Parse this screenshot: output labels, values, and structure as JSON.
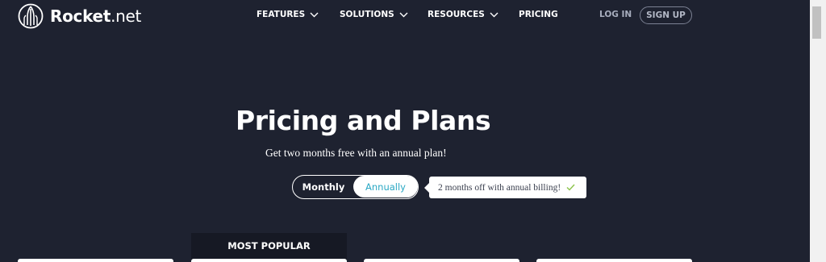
{
  "header": {
    "logo_text_bold": "Rocket",
    "logo_text_light": ".net",
    "nav": [
      {
        "label": "FEATURES",
        "has_dropdown": true
      },
      {
        "label": "SOLUTIONS",
        "has_dropdown": true
      },
      {
        "label": "RESOURCES",
        "has_dropdown": true
      },
      {
        "label": "PRICING",
        "has_dropdown": false
      }
    ],
    "login_label": "LOG IN",
    "signup_label": "SIGN UP"
  },
  "hero": {
    "title": "Pricing and Plans",
    "subtitle": "Get two months free with an annual plan!",
    "billing_toggle": {
      "options": [
        "Monthly",
        "Annually"
      ],
      "selected": "Annually"
    },
    "billing_note": "2 months off with annual billing!"
  },
  "plans": {
    "popular_label": "MOST POPULAR"
  },
  "icons": {
    "logo": "rocket-logo-icon",
    "dropdown": "chevron-down-icon",
    "note": "check-icon"
  },
  "colors": {
    "background": "#1e2230",
    "accent": "#2aa8c4",
    "check": "#8bc34a"
  }
}
